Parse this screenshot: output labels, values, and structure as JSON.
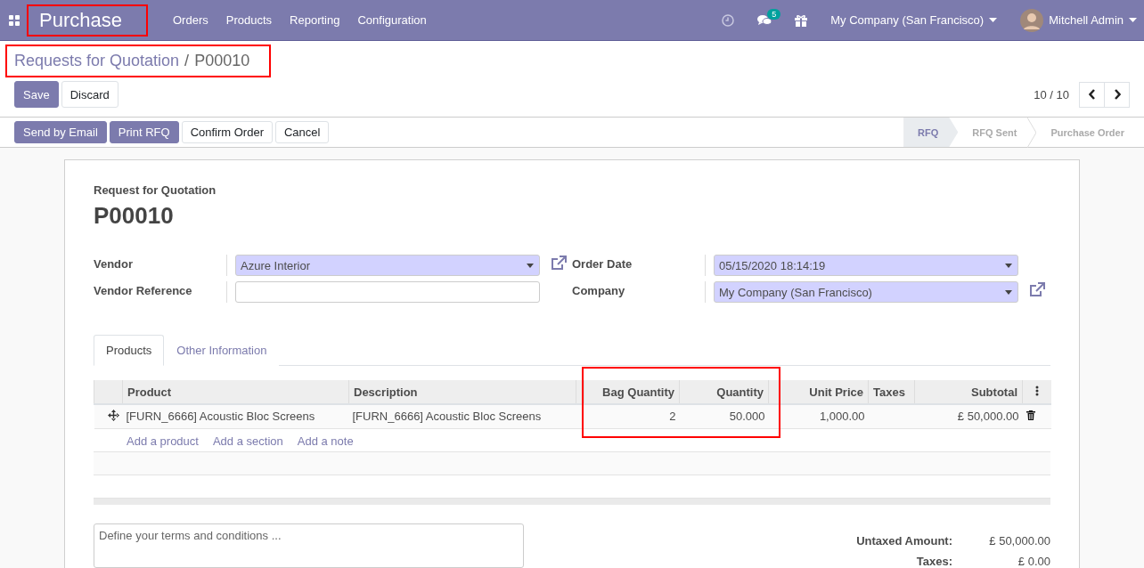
{
  "navbar": {
    "app_title": "Purchase",
    "app_title_highlighted": true,
    "menu": [
      "Orders",
      "Products",
      "Reporting",
      "Configuration"
    ],
    "messages_badge": "5",
    "company": "My Company (San Francisco)",
    "user": "Mitchell Admin"
  },
  "breadcrumb": {
    "items": [
      "Requests for Quotation",
      "P00010"
    ],
    "separator": "/",
    "highlighted": true
  },
  "form_buttons": [
    {
      "label": "Save",
      "primary": true
    },
    {
      "label": "Discard",
      "primary": false
    }
  ],
  "pager": {
    "text": "10 / 10"
  },
  "action_buttons": [
    {
      "label": "Send by Email",
      "primary": true
    },
    {
      "label": "Print RFQ",
      "primary": true
    },
    {
      "label": "Confirm Order",
      "primary": false
    },
    {
      "label": "Cancel",
      "primary": false
    }
  ],
  "status_steps": [
    {
      "label": "RFQ",
      "selected": true
    },
    {
      "label": "RFQ Sent",
      "selected": false
    },
    {
      "label": "Purchase Order",
      "selected": false
    }
  ],
  "sheet": {
    "subtitle": "Request for Quotation",
    "name": "P00010",
    "left_fields": [
      {
        "label": "Vendor",
        "kind": "select",
        "value": "Azure Interior",
        "external_link": true
      },
      {
        "label": "Vendor Reference",
        "kind": "input",
        "external_link": false
      }
    ],
    "right_fields": [
      {
        "label": "Order Date",
        "kind": "select",
        "value": "05/15/2020 18:14:19",
        "external_link": false
      },
      {
        "label": "Company",
        "kind": "select",
        "value": "My Company (San Francisco)",
        "external_link": true
      }
    ],
    "tabs": [
      {
        "label": "Products",
        "selected": true
      },
      {
        "label": "Other Information",
        "selected": false
      }
    ],
    "table": {
      "columns": [
        "Product",
        "Description",
        "Bag Quantity",
        "Quantity",
        "Unit Price",
        "Taxes",
        "Subtotal"
      ],
      "rows": [
        {
          "product": "[FURN_6666] Acoustic Bloc Screens",
          "description": "[FURN_6666] Acoustic Bloc Screens",
          "bag_quantity": "2",
          "quantity": "50.000",
          "unit_price": "1,000.00",
          "subtotal": "£ 50,000.00"
        }
      ],
      "add_links": [
        "Add a product",
        "Add a section",
        "Add a note"
      ],
      "quantity_columns_highlighted": true
    },
    "terms_placeholder": "Define your terms and conditions ...",
    "totals": [
      {
        "label": "Untaxed Amount:",
        "value": "£ 50,000.00"
      },
      {
        "label": "Taxes:",
        "value": "£ 0.00"
      }
    ]
  }
}
